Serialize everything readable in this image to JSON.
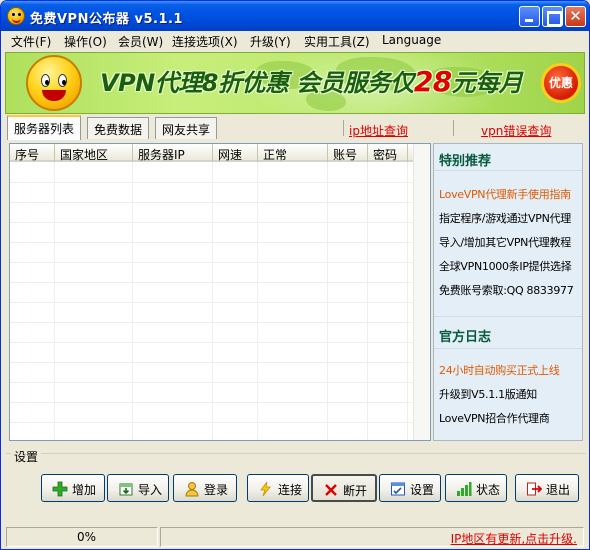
{
  "window": {
    "title": "免费VPN公布器 v5.1.1"
  },
  "menu": [
    {
      "label": "文件(F)"
    },
    {
      "label": "操作(O)"
    },
    {
      "label": "会员(W)"
    },
    {
      "label": "连接选项(X)"
    },
    {
      "label": "升级(Y)"
    },
    {
      "label": "实用工具(Z)"
    },
    {
      "label": "Language"
    }
  ],
  "banner": {
    "text_left": "VPN代理8折优惠 会员服务仅",
    "price": "28",
    "text_right": "元每月",
    "badge": "优惠"
  },
  "tabs": [
    {
      "label": "服务器列表",
      "active": true
    },
    {
      "label": "免费数据",
      "active": false
    },
    {
      "label": "网友共享",
      "active": false
    }
  ],
  "links": {
    "ip_query": "ip地址查询",
    "vpn_error_query": "vpn错误查询"
  },
  "table": {
    "columns": [
      "序号",
      "国家地区",
      "服务器IP",
      "网速",
      "正常",
      "账号",
      "密码"
    ],
    "rows": []
  },
  "sidebar": {
    "recommend_title": "特别推荐",
    "recommend_items": [
      {
        "label": "LoveVPN代理新手使用指南",
        "highlight": true
      },
      {
        "label": "指定程序/游戏通过VPN代理",
        "highlight": false
      },
      {
        "label": "导入/增加其它VPN代理教程",
        "highlight": false
      },
      {
        "label": "全球VPN1000条IP提供选择",
        "highlight": false
      },
      {
        "label": "免费账号索取:QQ 8833977",
        "highlight": false
      }
    ],
    "log_title": "官方日志",
    "log_items": [
      {
        "label": "24小时自动购买正式上线",
        "highlight": true
      },
      {
        "label": "升级到V5.1.1版通知",
        "highlight": false
      },
      {
        "label": "LoveVPN招合作代理商",
        "highlight": false
      }
    ]
  },
  "settings": {
    "group_label": "设置",
    "buttons": {
      "add": "增加",
      "import": "导入",
      "login": "登录",
      "connect": "连接",
      "disconnect": "断开",
      "settings": "设置",
      "status": "状态",
      "exit": "退出"
    }
  },
  "status_bar": {
    "progress": "0%",
    "update_notice": "IP地区有更新,点击升级."
  },
  "colors": {
    "title_bar": "#0054e3",
    "link_red": "#e00000",
    "highlight_orange": "#e05a00",
    "sidebar_heading": "#085a3e",
    "banner_green": "#b9e76b"
  }
}
